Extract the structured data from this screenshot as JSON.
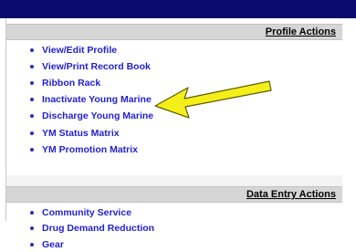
{
  "sections": [
    {
      "title": "Profile Actions",
      "items": [
        "View/Edit Profile",
        "View/Print Record Book",
        "Ribbon Rack",
        "Inactivate Young Marine",
        "Discharge Young Marine",
        "YM Status Matrix",
        "YM Promotion Matrix"
      ]
    },
    {
      "title": "Data Entry Actions",
      "items": [
        "Community Service",
        "Drug Demand Reduction",
        "Gear"
      ]
    }
  ],
  "colors": {
    "topbar": "#0b0b6b",
    "header_bg": "#d6d6d6",
    "link": "#1f1fd1",
    "arrow_fill": "#f5ef19",
    "arrow_outline": "#5d5d00"
  },
  "icons": {
    "bullet": "bullet-icon",
    "arrow": "yellow-arrow-annotation"
  }
}
